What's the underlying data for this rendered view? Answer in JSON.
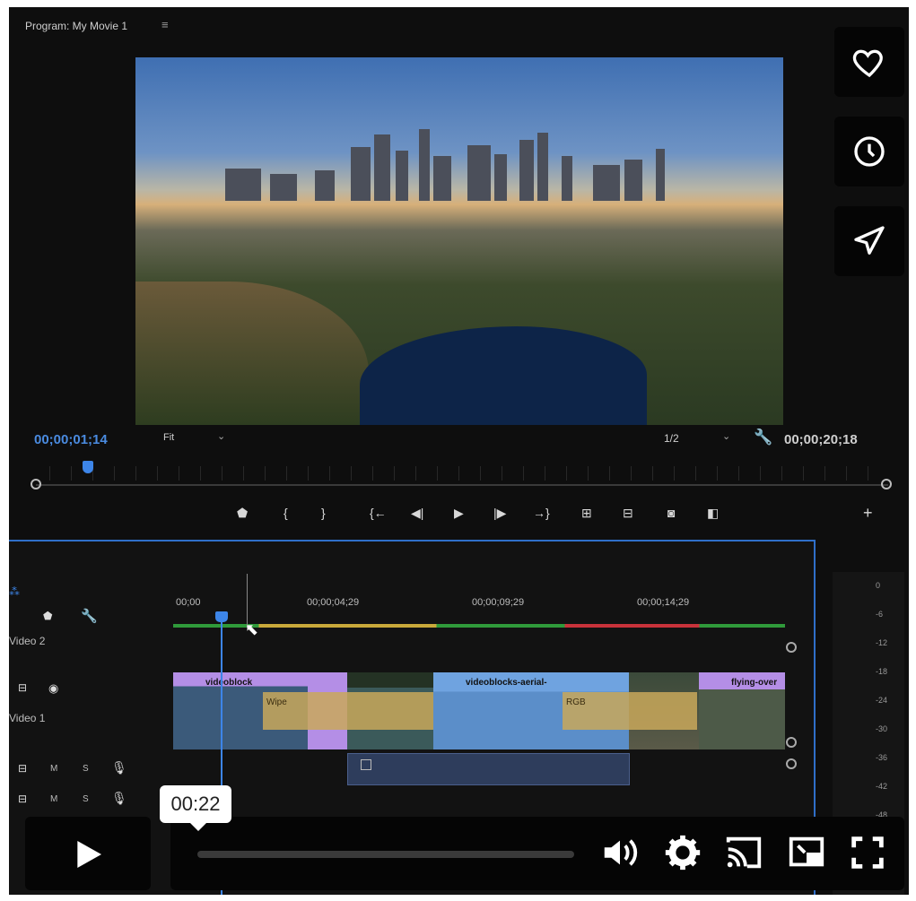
{
  "program": {
    "title": "Program: My Movie 1",
    "menu_icon": "menu-icon"
  },
  "viewer": {
    "timecode_current": "00;00;01;14",
    "fit_label": "Fit",
    "resolution": "1/2",
    "timecode_duration": "00;00;20;18"
  },
  "side_actions": [
    {
      "name": "heart-icon"
    },
    {
      "name": "clock-icon"
    },
    {
      "name": "send-icon"
    }
  ],
  "transport": {
    "icons": [
      "marker-icon",
      "mark-in-icon",
      "mark-out-icon",
      "go-to-in-icon",
      "step-back-icon",
      "play-icon",
      "step-forward-icon",
      "go-to-out-icon",
      "lift-icon",
      "extract-icon",
      "export-frame-icon",
      "comparison-view-icon",
      "add-button-icon"
    ]
  },
  "timeline": {
    "ruler": [
      "00;00",
      "00;00;04;29",
      "00;00;09;29",
      "00;00;14;29"
    ],
    "tracks": {
      "video2": "Video 2",
      "video1": "Video 1",
      "mute": "M",
      "solo": "S"
    },
    "clips": [
      {
        "label": "videoblock",
        "color": "#b48ee6"
      },
      {
        "label": "videoblocks-aerial-",
        "color": "#6fa3e0"
      },
      {
        "label": "flying-over",
        "color": "#b48ee6"
      }
    ],
    "transitions": [
      {
        "label": "Wipe"
      },
      {
        "label": "RGB"
      }
    ]
  },
  "meter": {
    "labels": [
      "0",
      "-6",
      "-12",
      "-18",
      "-24",
      "-30",
      "-36",
      "-42",
      "-48"
    ]
  },
  "player": {
    "tooltip": "00:22",
    "progress": 0.0,
    "controls": [
      "play-icon",
      "volume-icon",
      "settings-icon",
      "cast-icon",
      "picture-in-picture-icon",
      "fullscreen-icon"
    ]
  },
  "colors": {
    "accent": "#3d85e8",
    "frame_bg": "#0e0e0e",
    "clip_purple": "#b48ee6",
    "clip_blue": "#6fa3e0",
    "transition": "#c9a85a"
  }
}
